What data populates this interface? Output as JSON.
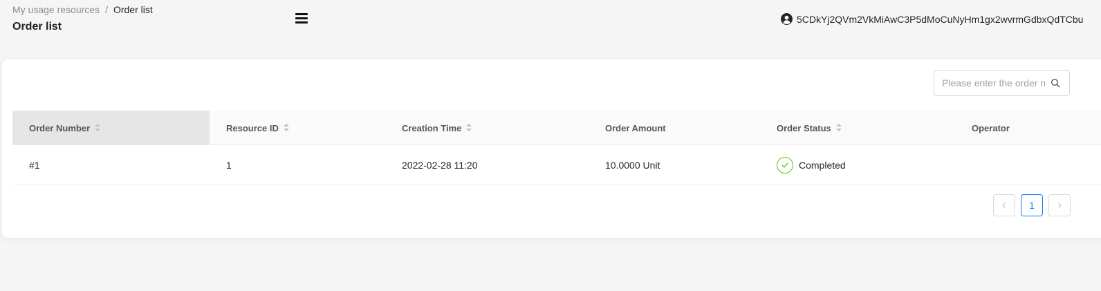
{
  "breadcrumb": {
    "items": [
      "My usage resources",
      "Order list"
    ],
    "separator": "/"
  },
  "page_title": "Order list",
  "account": {
    "address": "5CDkYj2QVm2VkMiAwC3P5dMoCuNyHm1gx2wvrmGdbxQdTCbu",
    "icon": "user-circle-icon"
  },
  "search": {
    "placeholder": "Please enter the order number",
    "value": "",
    "icon": "search-icon"
  },
  "table": {
    "columns": [
      {
        "label": "Order Number",
        "sortable": true
      },
      {
        "label": "Resource ID",
        "sortable": true
      },
      {
        "label": "Creation Time",
        "sortable": true
      },
      {
        "label": "Order Amount",
        "sortable": false
      },
      {
        "label": "Order Status",
        "sortable": true
      },
      {
        "label": "Operator",
        "sortable": false
      }
    ],
    "rows": [
      {
        "order_number": "#1",
        "resource_id": "1",
        "creation_time": "2022-02-28 11:20",
        "order_amount": "10.0000 Unit",
        "order_status": "Completed",
        "operator": ""
      }
    ]
  },
  "pagination": {
    "current_page": "1",
    "prev_icon": "chevron-left-icon",
    "next_icon": "chevron-right-icon"
  },
  "colors": {
    "accent": "#1677ff",
    "success": "#52c41a",
    "background": "#f5f5f5",
    "sorted_header": "#e6e6e6"
  }
}
